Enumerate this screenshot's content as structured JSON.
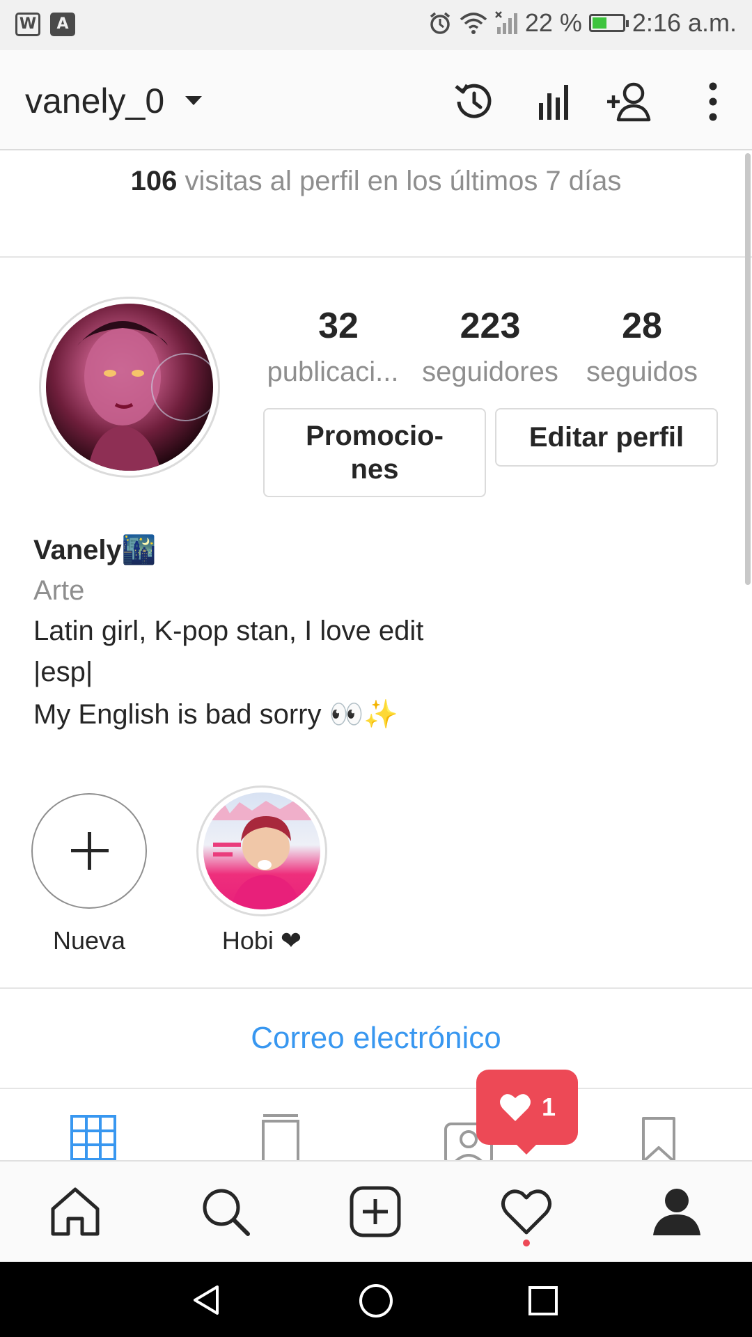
{
  "status_bar": {
    "left_icons": [
      "W",
      "A"
    ],
    "battery_text": "22 %",
    "time": "2:16 a.m."
  },
  "header": {
    "username": "vanely_0",
    "icons": [
      "history-icon",
      "insights-icon",
      "add-person-icon",
      "more-icon"
    ]
  },
  "visits": {
    "count": "106",
    "text": " visitas al perfil en los últimos 7 días"
  },
  "stats": [
    {
      "value": "32",
      "label": "publicaci..."
    },
    {
      "value": "223",
      "label": "seguidores"
    },
    {
      "value": "28",
      "label": "seguidos"
    }
  ],
  "buttons": {
    "promotions": "Promocio-\nnes",
    "edit_profile": "Editar perfil"
  },
  "bio": {
    "name": "Vanely🌃",
    "category": "Arte",
    "lines": [
      "Latin girl, K-pop stan, I love edit",
      "|esp|",
      "My English is bad sorry 👀✨"
    ]
  },
  "highlights": [
    {
      "label": "Nueva"
    },
    {
      "label": "Hobi ❤"
    }
  ],
  "contact": {
    "email_label": "Correo electrónico"
  },
  "notification": {
    "count": "1"
  },
  "colors": {
    "accent_blue": "#3897f0",
    "notification_red": "#ed4956"
  }
}
